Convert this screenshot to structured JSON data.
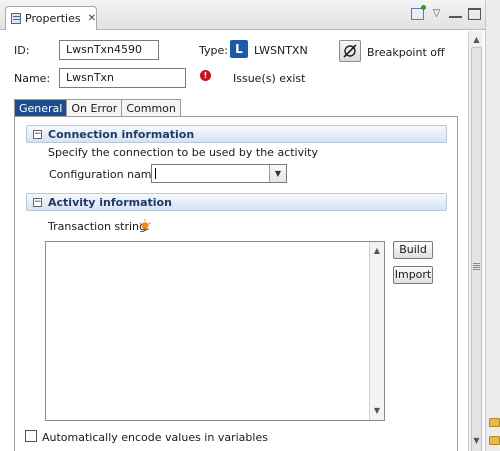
{
  "view": {
    "tab_label": "Properties",
    "close_glyph": "✕"
  },
  "header": {
    "id_label": "ID:",
    "id_value": "LwsnTxn4590",
    "type_label": "Type:",
    "type_icon_letter": "L",
    "type_value": "LWSNTXN",
    "breakpoint_label": "Breakpoint off",
    "name_label": "Name:",
    "name_value": "LwsnTxn",
    "issue_text": "Issue(s) exist"
  },
  "tabs": [
    {
      "label": "General",
      "active": true
    },
    {
      "label": "On Error",
      "active": false
    },
    {
      "label": "Common",
      "active": false
    }
  ],
  "connection": {
    "title": "Connection information",
    "description": "Specify the connection to be used by the activity",
    "config_label": "Configuration name:",
    "config_value": ""
  },
  "activity": {
    "title": "Activity information",
    "transaction_label": "Transaction string:",
    "transaction_value": "",
    "build_label": "Build",
    "import_label": "Import"
  },
  "encode_checkbox": {
    "label": "Automatically encode values in variables",
    "checked": false
  },
  "colors": {
    "active_tab": "#1c4d8c",
    "section_title": "#1e3a6b",
    "type_icon": "#1b5aa8",
    "error": "#c8151b",
    "bulb": "#f08a1c"
  },
  "icons": [
    "properties-view-icon",
    "pin-icon",
    "view-menu-icon",
    "minimize-icon",
    "maximize-icon",
    "lwsntxn-type-icon",
    "breakpoint-icon",
    "error-icon",
    "collapse-icon",
    "lightbulb-icon",
    "dropdown-arrow-icon",
    "scroll-up-icon",
    "scroll-down-icon",
    "folder-icon"
  ]
}
